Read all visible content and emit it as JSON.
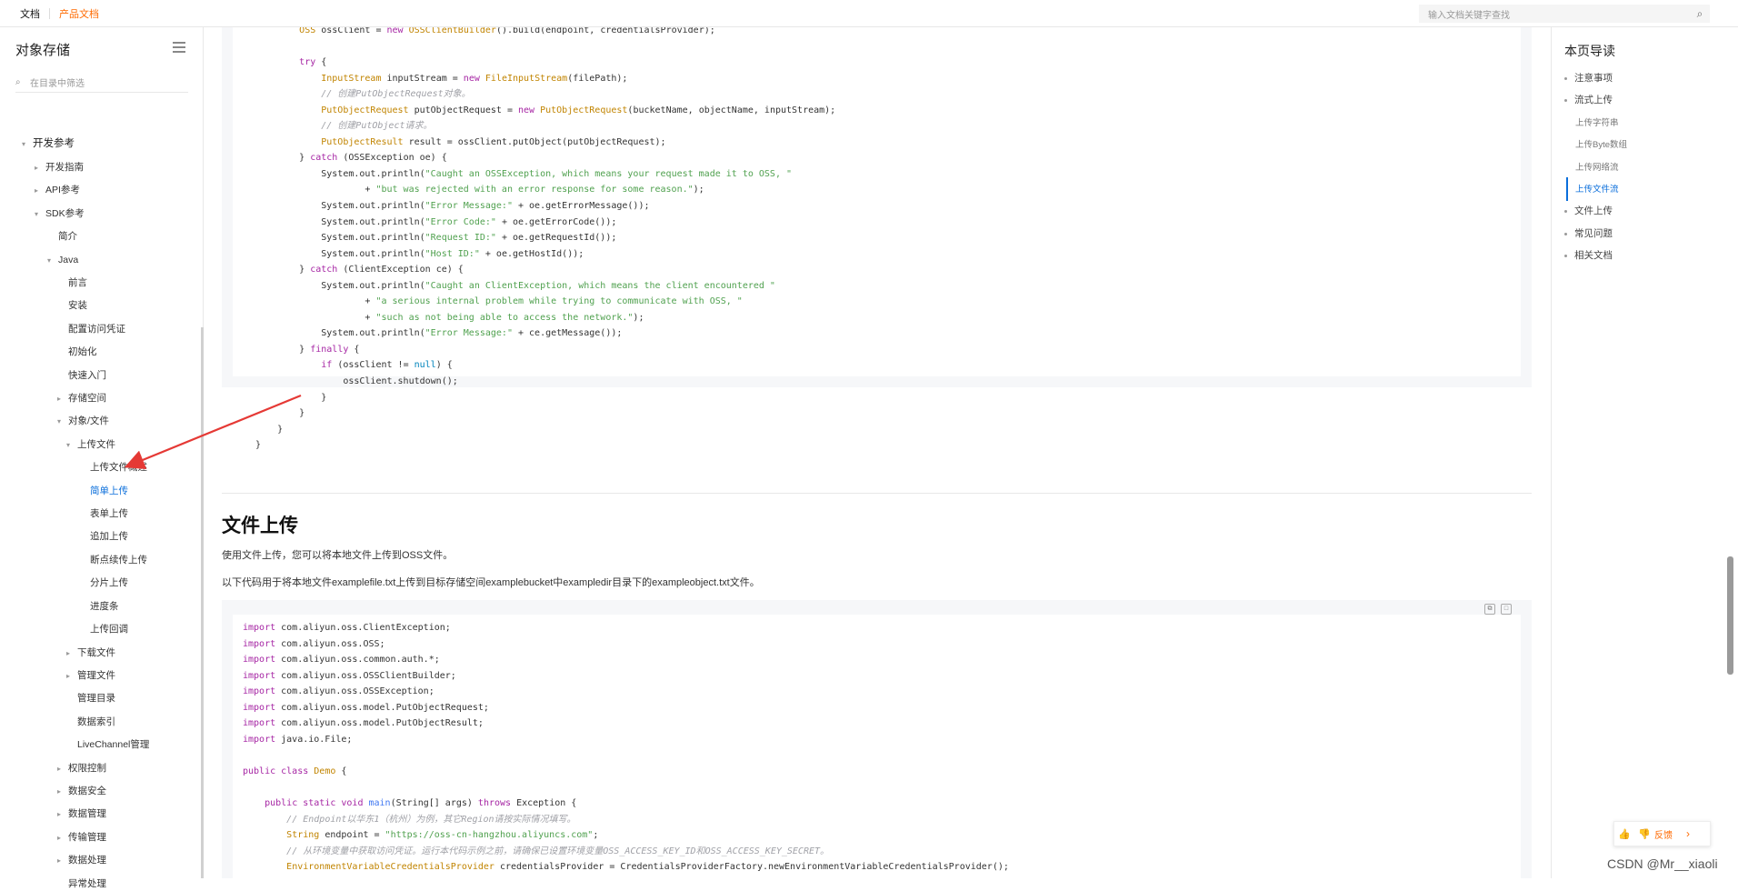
{
  "topbar": {
    "tabs": [
      "文档",
      "产品文档"
    ],
    "search_placeholder": "输入文档关键字查找"
  },
  "sidebar": {
    "title": "对象存储",
    "filter_placeholder": "在目录中筛选",
    "items": [
      {
        "label": "开发参考",
        "level": 0,
        "caret": "▾"
      },
      {
        "label": "开发指南",
        "level": 1,
        "caret": "▸"
      },
      {
        "label": "API参考",
        "level": 1,
        "caret": "▸"
      },
      {
        "label": "SDK参考",
        "level": 1,
        "caret": "▾"
      },
      {
        "label": "简介",
        "level": 2,
        "caret": ""
      },
      {
        "label": "Java",
        "level": 2,
        "caret": "▾"
      },
      {
        "label": "前言",
        "level": 3,
        "caret": ""
      },
      {
        "label": "安装",
        "level": 3,
        "caret": ""
      },
      {
        "label": "配置访问凭证",
        "level": 3,
        "caret": ""
      },
      {
        "label": "初始化",
        "level": 3,
        "caret": ""
      },
      {
        "label": "快速入门",
        "level": 3,
        "caret": ""
      },
      {
        "label": "存储空间",
        "level": 3,
        "caret": "▸"
      },
      {
        "label": "对象/文件",
        "level": 3,
        "caret": "▾"
      },
      {
        "label": "上传文件",
        "level": 4,
        "caret": "▾"
      },
      {
        "label": "上传文件概述",
        "level": 5,
        "caret": ""
      },
      {
        "label": "简单上传",
        "level": 5,
        "caret": "",
        "active": true
      },
      {
        "label": "表单上传",
        "level": 5,
        "caret": ""
      },
      {
        "label": "追加上传",
        "level": 5,
        "caret": ""
      },
      {
        "label": "断点续传上传",
        "level": 5,
        "caret": ""
      },
      {
        "label": "分片上传",
        "level": 5,
        "caret": ""
      },
      {
        "label": "进度条",
        "level": 5,
        "caret": ""
      },
      {
        "label": "上传回调",
        "level": 5,
        "caret": ""
      },
      {
        "label": "下载文件",
        "level": 4,
        "caret": "▸"
      },
      {
        "label": "管理文件",
        "level": 4,
        "caret": "▸"
      },
      {
        "label": "管理目录",
        "level": 4,
        "caret": ""
      },
      {
        "label": "数据索引",
        "level": 4,
        "caret": ""
      },
      {
        "label": "LiveChannel管理",
        "level": 4,
        "caret": ""
      },
      {
        "label": "权限控制",
        "level": 3,
        "caret": "▸"
      },
      {
        "label": "数据安全",
        "level": 3,
        "caret": "▸"
      },
      {
        "label": "数据管理",
        "level": 3,
        "caret": "▸"
      },
      {
        "label": "传输管理",
        "level": 3,
        "caret": "▸"
      },
      {
        "label": "数据处理",
        "level": 3,
        "caret": "▸"
      },
      {
        "label": "异常处理",
        "level": 3,
        "caret": ""
      }
    ]
  },
  "main": {
    "section_title": "文件上传",
    "para1": "使用文件上传，您可以将本地文件上传到OSS文件。",
    "para2": "以下代码用于将本地文件examplefile.txt上传到目标存储空间examplebucket中exampledir目录下的exampleobject.txt文件。"
  },
  "toc": {
    "title": "本页导读",
    "items": [
      {
        "label": "注意事项",
        "sub": false
      },
      {
        "label": "流式上传",
        "sub": false
      },
      {
        "label": "上传字符串",
        "sub": true
      },
      {
        "label": "上传Byte数组",
        "sub": true
      },
      {
        "label": "上传网络流",
        "sub": true
      },
      {
        "label": "上传文件流",
        "sub": true,
        "active": true
      },
      {
        "label": "文件上传",
        "sub": false
      },
      {
        "label": "常见问题",
        "sub": false
      },
      {
        "label": "相关文档",
        "sub": false
      }
    ]
  },
  "feedback": {
    "label": "反馈"
  },
  "watermark": "CSDN @Mr__xiaoli"
}
